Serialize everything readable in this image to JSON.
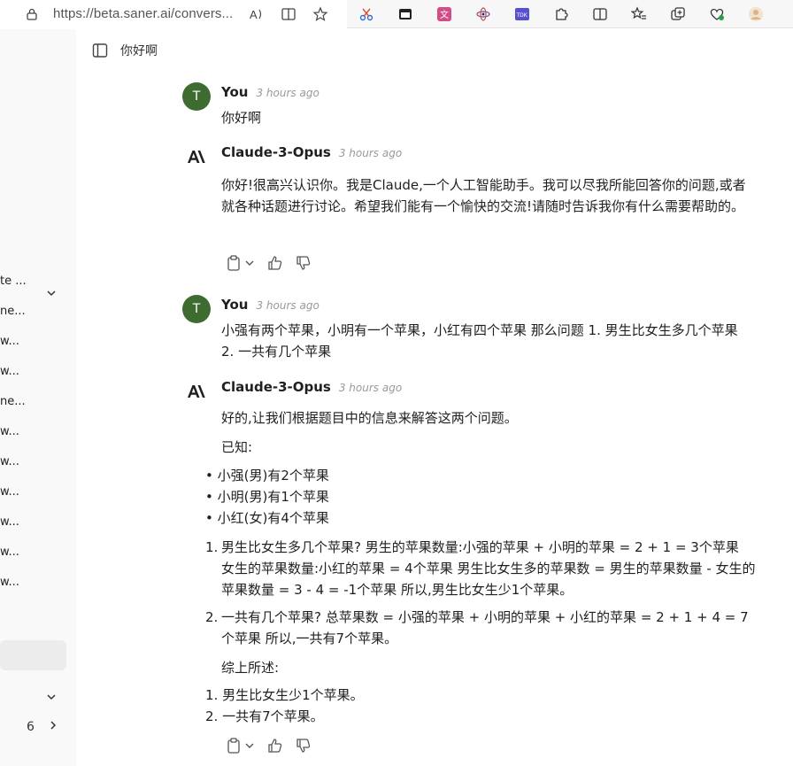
{
  "browser": {
    "url": "https://beta.saner.ai/convers...",
    "accent": "#3e6b2f"
  },
  "sidebar": {
    "items": [
      "te ...",
      "ne...",
      "w...",
      "w...",
      "ne...",
      "w...",
      "w...",
      "w...",
      "w...",
      "w...",
      "w..."
    ],
    "count": "6"
  },
  "header": {
    "title": "你好啊"
  },
  "messages": [
    {
      "author": "You",
      "avatar": "T",
      "time": "3 hours ago",
      "text": "你好啊"
    },
    {
      "author": "Claude-3-Opus",
      "time": "3 hours ago",
      "text": "你好!很高兴认识你。我是Claude,一个人工智能助手。我可以尽我所能回答你的问题,或者就各种话题进行讨论。希望我们能有一个愉快的交流!请随时告诉我你有什么需要帮助的。"
    },
    {
      "author": "You",
      "avatar": "T",
      "time": "3 hours ago",
      "text": "小强有两个苹果，小明有一个苹果，小红有四个苹果 那么问题 1. 男生比女生多几个苹果 2. 一共有几个苹果"
    },
    {
      "author": "Claude-3-Opus",
      "time": "3 hours ago",
      "intro": "好的,让我们根据题目中的信息来解答这两个问题。",
      "known": "已知:",
      "bullets": [
        "小强(男)有2个苹果",
        "小明(男)有1个苹果",
        "小红(女)有4个苹果"
      ],
      "answers": [
        "男生比女生多几个苹果? 男生的苹果数量:小强的苹果 + 小明的苹果 = 2 + 1 = 3个苹果 女生的苹果数量:小红的苹果 = 4个苹果 男生比女生多的苹果数 = 男生的苹果数量 - 女生的苹果数量 = 3 - 4 = -1个苹果 所以,男生比女生少1个苹果。",
        "一共有几个苹果? 总苹果数 = 小强的苹果 + 小明的苹果 + 小红的苹果 = 2 + 1 + 4 = 7个苹果 所以,一共有7个苹果。"
      ],
      "summary": "综上所述:",
      "conclusions": [
        "男生比女生少1个苹果。",
        "一共有7个苹果。"
      ]
    }
  ]
}
